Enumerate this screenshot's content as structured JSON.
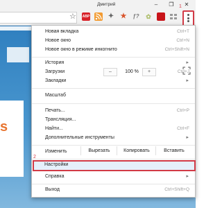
{
  "window": {
    "user": "Дмитрий",
    "minimize_icon": "minimize-icon",
    "restore_icon": "restore-icon",
    "close_icon": "close-icon"
  },
  "toolbar": {
    "bookmark_icon": "star-icon",
    "extensions": [
      {
        "name": "adblock-icon",
        "text": "ABP",
        "color": "#d8232a"
      },
      {
        "name": "rss-icon",
        "text": "",
        "color": "#f29b32"
      },
      {
        "name": "puzzle-icon",
        "text": "",
        "color": "#666666"
      },
      {
        "name": "star-extension-icon",
        "text": "",
        "color": "#d8542b"
      },
      {
        "name": "formula-icon",
        "text": "",
        "color": "#777777"
      },
      {
        "name": "shopping-icon",
        "text": "",
        "color": "#b0c070"
      },
      {
        "name": "red-square-icon",
        "text": "",
        "color": "#c8141a"
      },
      {
        "name": "grid-icon",
        "text": "",
        "color": "#999999"
      }
    ]
  },
  "annotations": {
    "step1": "1",
    "step2": "2",
    "highlight_color": "#d23a46"
  },
  "page": {
    "fragment_letter": "s"
  },
  "menu": {
    "new_tab": {
      "label": "Новая вкладка",
      "shortcut": "Ctrl+T"
    },
    "new_window": {
      "label": "Новое окно",
      "shortcut": "Ctrl+N"
    },
    "incognito": {
      "label": "Новое окно в режиме инкогнито",
      "shortcut": "Ctrl+Shift+N"
    },
    "history": {
      "label": "История"
    },
    "downloads": {
      "label": "Загрузки",
      "shortcut": "Ctrl+J"
    },
    "bookmarks": {
      "label": "Закладки"
    },
    "zoom": {
      "label": "Масштаб",
      "minus": "–",
      "value": "100 %",
      "plus": "+"
    },
    "print": {
      "label": "Печать...",
      "shortcut": "Ctrl+P"
    },
    "cast": {
      "label": "Трансляция..."
    },
    "find": {
      "label": "Найти...",
      "shortcut": "Ctrl+F"
    },
    "more_tools": {
      "label": "Дополнительные инструменты"
    },
    "edit": {
      "label": "Изменить",
      "cut": "Вырезать",
      "copy": "Копировать",
      "paste": "Вставить"
    },
    "settings": {
      "label": "Настройки"
    },
    "help": {
      "label": "Справка"
    },
    "exit": {
      "label": "Выход",
      "shortcut": "Ctrl+Shift+Q"
    },
    "submenu_arrow": "▸"
  }
}
